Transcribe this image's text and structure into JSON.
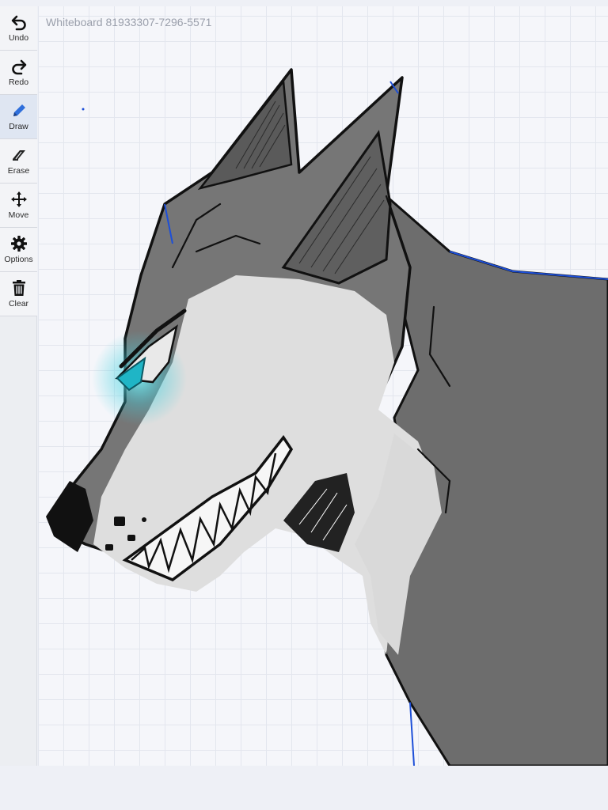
{
  "board": {
    "title": "Whiteboard 81933307-7296-5571"
  },
  "toolbar": {
    "items": [
      {
        "label": "Undo",
        "icon": "undo-icon"
      },
      {
        "label": "Redo",
        "icon": "redo-icon"
      },
      {
        "label": "Draw",
        "icon": "pencil-icon",
        "active": true
      },
      {
        "label": "Erase",
        "icon": "eraser-icon"
      },
      {
        "label": "Move",
        "icon": "move-arrows-icon"
      },
      {
        "label": "Options",
        "icon": "gear-icon"
      },
      {
        "label": "Clear",
        "icon": "trash-icon"
      }
    ]
  },
  "colors": {
    "accent": "#2f6fdb",
    "fur_dark": "#6f6f6f",
    "fur_light": "#dcdcdc",
    "eye_glow": "#38d6e6",
    "outline": "#111111"
  }
}
